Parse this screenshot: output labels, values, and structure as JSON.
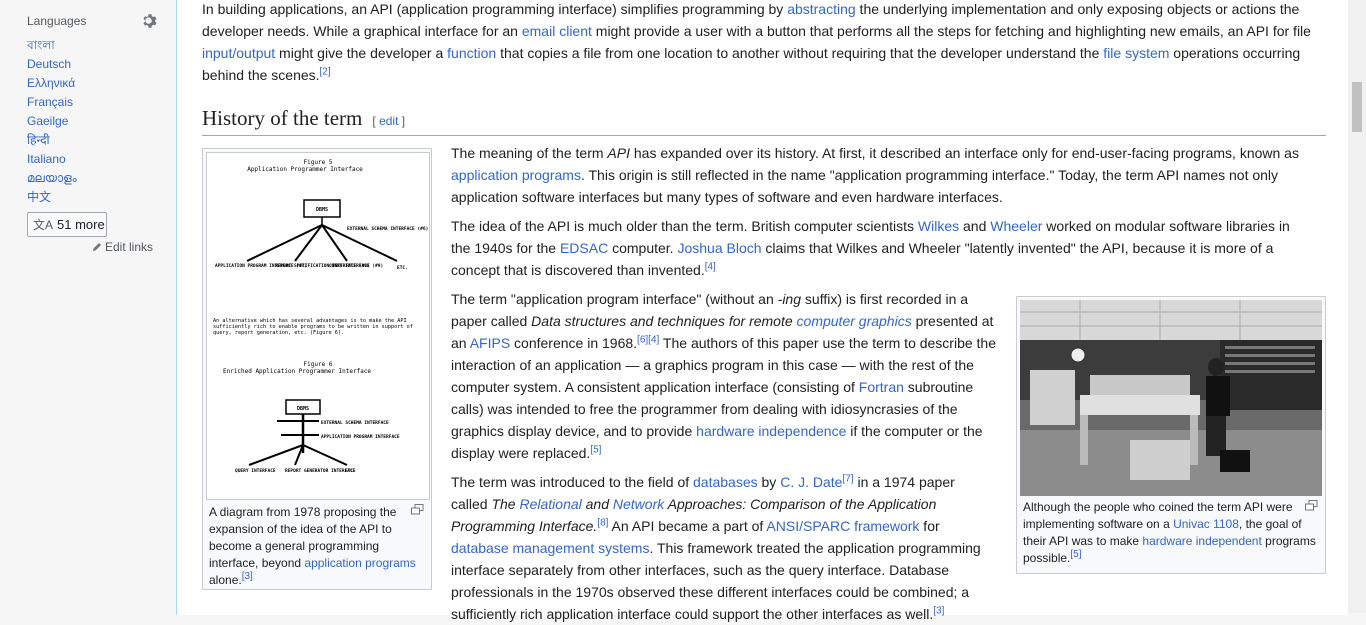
{
  "sidebar": {
    "languages_label": "Languages",
    "languages": [
      "বাংলা",
      "Deutsch",
      "Ελληνικά",
      "Français",
      "Gaeilge",
      "हिन्दी",
      "Italiano",
      "മലയാളം",
      "中文"
    ],
    "more_label": "51 more",
    "edit_links": "Edit links"
  },
  "intro": {
    "t1": "In building applications, an API (application programming interface) simplifies programming by ",
    "l1": "abstracting",
    "t2": " the underlying implementation and only exposing objects or actions the developer needs. While a graphical interface for an ",
    "l2": "email client",
    "t3": " might provide a user with a button that performs all the steps for fetching and highlighting new emails, an API for file ",
    "l3": "input/output",
    "t4": " might give the developer a ",
    "l4": "function",
    "t5": " that copies a file from one location to another without requiring that the developer understand the ",
    "l5": "file system",
    "t6": " operations occurring behind the scenes.",
    "ref": "[2]"
  },
  "section": {
    "title": "History of the term",
    "edit_open": "[ ",
    "edit": "edit",
    "edit_close": " ]"
  },
  "figure_left": {
    "fig5_title": "Figure 5",
    "fig5_sub": "Application Programmer Interface",
    "dbms": "DBMS",
    "ext_schema": "EXTERNAL SCHEMA INTERFACE (#6)",
    "api7": "APPLICATION PROGRAM INTERFACE (#7)",
    "rsi8": "REPORT SPECIFICATION INTERFACE (#8)",
    "qi9": "QUERY INTERFACE (#9)",
    "etc": "ETC.",
    "alt_text": "An alternative which has several advantages is to make the API sufficiently rich to enable programs to be written in support of query, report generation, etc. (Figure 6).",
    "fig6_title": "Figure 6",
    "fig6_sub": "Enriched Application Programmer Interface",
    "ext_schema2": "EXTERNAL SCHEMA INTERFACE",
    "api_int": "APPLICATION PROGRAM INTERFACE",
    "query_int": "QUERY INTERFACE",
    "report_gen": "REPORT GENERATOR INTERFACE",
    "caption_t1": "A diagram from 1978 proposing the expansion of the idea of the API to become a general programming interface, beyond ",
    "caption_link": "application programs",
    "caption_t2": " alone.",
    "caption_ref": "[3]"
  },
  "para1": {
    "t1": "The meaning of the term ",
    "em": "API",
    "t2": " has expanded over its history. At first, it described an interface only for end-user-facing programs, known as ",
    "l1": "application programs",
    "t3": ". This origin is still reflected in the name \"application programming interface.\" Today, the term API names not only application software interfaces but many types of software and even hardware interfaces."
  },
  "para2": {
    "t1": "The idea of the API is much older than the term. British computer scientists ",
    "l1": "Wilkes",
    "t2": " and ",
    "l2": "Wheeler",
    "t3": " worked on modular software libraries in the 1940s for the ",
    "l3": "EDSAC",
    "t4": " computer. ",
    "l4": "Joshua Bloch",
    "t5": " claims that Wilkes and Wheeler \"latently invented\" the API, because it is more of a concept that is discovered than invented.",
    "ref": "[4]"
  },
  "para3": {
    "t1": "The term \"application program interface\" (without an ",
    "em1": "-ing",
    "t2": " suffix) is first recorded in a paper called ",
    "em2": "Data structures and techniques for remote ",
    "l1": "computer graphics",
    "t3": " presented at an ",
    "l2": "AFIPS",
    "t4": " conference in 1968.",
    "ref1": "[6][4]",
    "t5": " The authors of this paper use the term to describe the interaction of an application — a graphics program in this case — with the rest of the computer system. A consistent application interface (consisting of ",
    "l3": "Fortran",
    "t6": " subroutine calls) was intended to free the programmer from dealing with idiosyncrasies of the graphics display device, and to provide ",
    "l4": "hardware independence",
    "t7": " if the computer or the display were replaced.",
    "ref2": "[5]"
  },
  "para4": {
    "t1": "The term was introduced to the field of ",
    "l1": "databases",
    "t2": " by ",
    "l2": "C. J. Date",
    "ref1": "[7]",
    "t3": " in a 1974 paper called ",
    "em1": "The ",
    "l3": "Relational",
    "em2": " and ",
    "l4": "Network",
    "em3": " Approaches: Comparison of the Application Programming Interface.",
    "ref2": "[8]",
    "t4": " An API became a part of ",
    "l5": "ANSI/SPARC framework",
    "t5": " for ",
    "l6": "database management systems",
    "t6": ". This framework treated the application programming interface separately from other interfaces, such as the query interface. Database professionals in the 1970s observed these different interfaces could be combined; a sufficiently rich application interface could support the other interfaces as well.",
    "ref3": "[3]"
  },
  "figure_right": {
    "caption_t1": "Although the people who coined the term API were implementing software on a ",
    "l1": "Univac 1108",
    "caption_t2": ", the goal of their API was to make ",
    "l2": "hardware independent",
    "caption_t3": " programs possible.",
    "ref": "[5]"
  }
}
